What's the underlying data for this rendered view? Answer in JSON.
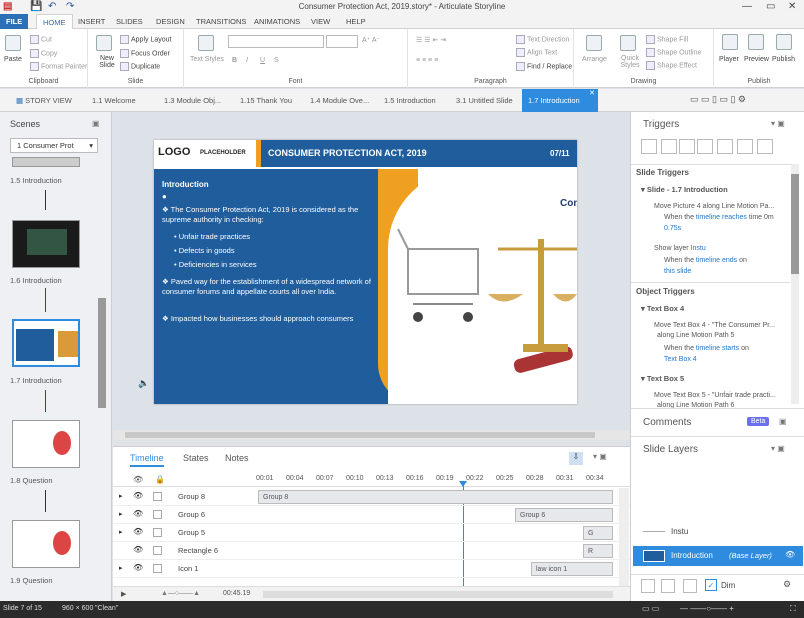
{
  "window": {
    "title": "Consumer Protection Act, 2019.story* - Articulate Storyline"
  },
  "menu": [
    "FILE",
    "HOME",
    "INSERT",
    "SLIDES",
    "DESIGN",
    "TRANSITIONS",
    "ANIMATIONS",
    "VIEW",
    "HELP"
  ],
  "ribbon": {
    "paste": "Paste",
    "cut": "Cut",
    "copy": "Copy",
    "format_painter": "Format Painter",
    "clipboard": "Clipboard",
    "new_slide": "New Slide",
    "apply_layout": "Apply Layout",
    "focus_order": "Focus Order",
    "duplicate": "Duplicate",
    "slide": "Slide",
    "text_styles": "Text Styles",
    "font": "Font",
    "text_direction": "Text Direction",
    "align_text": "Align Text",
    "find_replace": "Find / Replace",
    "paragraph": "Paragraph",
    "arrange": "Arrange",
    "quick_styles": "Quick Styles",
    "shape_fill": "Shape Fill",
    "shape_outline": "Shape Outline",
    "shape_effect": "Shape Effect",
    "drawing": "Drawing",
    "player": "Player",
    "preview": "Preview",
    "publish": "Publish",
    "publish_group": "Publish"
  },
  "tabs": [
    "STORY VIEW",
    "1.1 Welcome",
    "1.3 Module Obj...",
    "1.15 Thank You",
    "1.4 Module Ove...",
    "1.5 Introduction",
    "3.1 Untitled Slide",
    "1.7 Introduction"
  ],
  "scenes": {
    "title": "Scenes",
    "dropdown": "1 Consumer Prot",
    "labels": [
      "1.5 Introduction",
      "1.6 Introduction",
      "1.7 Introduction",
      "1.8 Question",
      "1.9 Question"
    ]
  },
  "slide": {
    "logo": "LOGO",
    "logo_sub": "PLACEHOLDER",
    "header": "CONSUMER PROTECTION ACT, 2019",
    "page": "07/11",
    "heading": "Introduction",
    "p1": "The Consumer Protection Act, 2019 is considered as the supreme authority in checking:",
    "b1": "Unfair trade practices",
    "b2": "Defects in goods",
    "b3": "Deficiencies in services",
    "p2": "Paved way for the establishment of a widespread network of consumer forums and appellate courts all over India.",
    "p3": "Impacted how businesses should approach consumers",
    "img_text": "Consum"
  },
  "timeline": {
    "tabs": [
      "Timeline",
      "States",
      "Notes"
    ],
    "ticks": [
      "00:01",
      "00:04",
      "00:07",
      "00:10",
      "00:13",
      "00:16",
      "00:19",
      "00:22",
      "00:25",
      "00:28",
      "00:31",
      "00:34"
    ],
    "rows": [
      "Group 8",
      "Group 6",
      "Group 5",
      "Rectangle 6",
      "Icon 1"
    ],
    "bars": [
      "Group 8",
      "Group 6",
      "G",
      "R",
      "law icon 1"
    ],
    "duration": "00:45.19"
  },
  "triggers": {
    "title": "Triggers",
    "slide_triggers": "Slide Triggers",
    "slide_name": "Slide - 1.7 Introduction",
    "t1a": "Move Picture 4 along Line Motion Pa...",
    "t1b": "When the",
    "t1c": "timeline reaches",
    "t1d": "time 0m",
    "t1e": "0.75s",
    "t2a": "Show layer",
    "t2b": "Instu",
    "t2c": "When the",
    "t2d": "timeline ends",
    "t2e": "on",
    "t2f": "this slide",
    "object_triggers": "Object Triggers",
    "tb4": "Text Box 4",
    "t3a": "Move Text Box 4 - \"The Consumer Pr...",
    "t3b": "along Line Motion Path 5",
    "t3c": "When the",
    "t3d": "timeline starts",
    "t3e": "on",
    "t3f": "Text Box 4",
    "tb5": "Text Box 5",
    "t4a": "Move Text Box 5 - \"Unfair trade practi...",
    "t4b": "along Line Motion Path 6"
  },
  "comments": {
    "title": "Comments",
    "badge": "Beta"
  },
  "layers": {
    "title": "Slide Layers",
    "layer1": "Instu",
    "base": "Introduction",
    "base_tag": "(Base Layer)",
    "dim": "Dim"
  },
  "status": {
    "slide": "Slide 7 of 15",
    "size": "960 × 600",
    "theme": "\"Clean\""
  }
}
